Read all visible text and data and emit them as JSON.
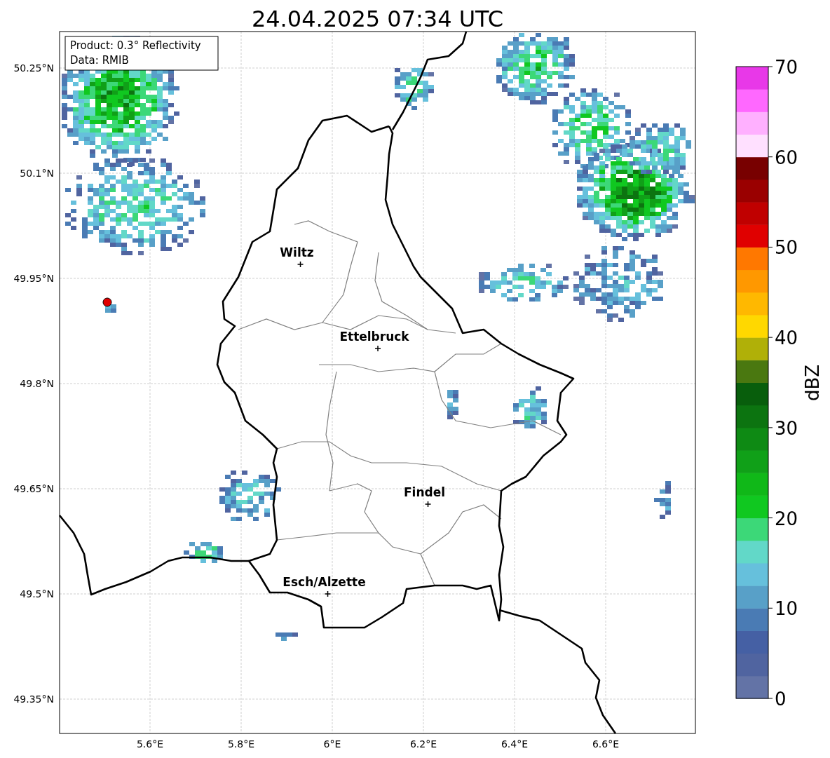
{
  "title": "24.04.2025 07:34 UTC",
  "info_box": [
    "Product: 0.3° Reflectivity",
    "Data: RMIB"
  ],
  "map": {
    "lat_ticks": [
      "50.25°N",
      "50.1°N",
      "49.95°N",
      "49.8°N",
      "49.65°N",
      "49.5°N",
      "49.35°N"
    ],
    "lon_ticks": [
      "5.6°E",
      "5.8°E",
      "6°E",
      "6.2°E",
      "6.4°E",
      "6.6°E"
    ],
    "cities": [
      {
        "name": "Wiltz"
      },
      {
        "name": "Ettelbruck"
      },
      {
        "name": "Findel"
      },
      {
        "name": "Esch/Alzette"
      }
    ]
  },
  "colorbar": {
    "label": "dBZ",
    "ticks": [
      "70",
      "60",
      "50",
      "40",
      "30",
      "20",
      "10",
      "0"
    ],
    "segments": [
      {
        "color": "#6373a6"
      },
      {
        "color": "#5064a0"
      },
      {
        "color": "#4560a4"
      },
      {
        "color": "#4a7bb4"
      },
      {
        "color": "#58a0c8"
      },
      {
        "color": "#66c0dc"
      },
      {
        "color": "#62d8c8"
      },
      {
        "color": "#3cd878"
      },
      {
        "color": "#10c820"
      },
      {
        "color": "#10b818"
      },
      {
        "color": "#10a018"
      },
      {
        "color": "#0e8a14"
      },
      {
        "color": "#0c7410"
      },
      {
        "color": "#085e0c"
      },
      {
        "color": "#4a7810"
      },
      {
        "color": "#b0b008"
      },
      {
        "color": "#ffd800"
      },
      {
        "color": "#ffb800"
      },
      {
        "color": "#ff9800"
      },
      {
        "color": "#ff7800"
      },
      {
        "color": "#e00000"
      },
      {
        "color": "#c00000"
      },
      {
        "color": "#9a0000"
      },
      {
        "color": "#780000"
      },
      {
        "color": "#ffe0ff"
      },
      {
        "color": "#ffb0ff"
      },
      {
        "color": "#ff68ff"
      },
      {
        "color": "#e838e8"
      }
    ]
  }
}
